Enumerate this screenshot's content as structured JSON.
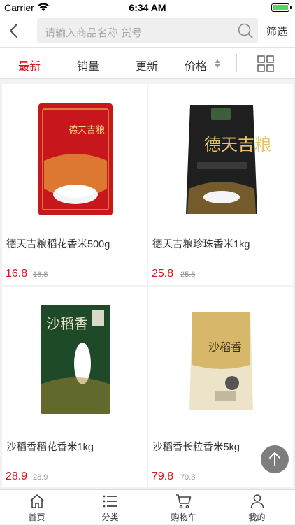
{
  "status_bar": {
    "carrier": "Carrier",
    "time": "6:34 AM"
  },
  "nav": {
    "search_placeholder": "请输入商品名称 货号",
    "filter_label": "筛选"
  },
  "sort_tabs": [
    {
      "label": "最新",
      "active": true
    },
    {
      "label": "销量",
      "active": false
    },
    {
      "label": "更新",
      "active": false
    },
    {
      "label": "价格",
      "active": false
    }
  ],
  "products": [
    {
      "name": "德天吉粮稻花香米500g",
      "price": "16.8",
      "old_price": "16.8",
      "pack_color": "#c8161d",
      "pack_text": "德天吉粮"
    },
    {
      "name": "德天吉粮珍珠香米1kg",
      "price": "25.8",
      "old_price": "25.8",
      "pack_color": "#1f1f1f",
      "pack_text": "德天吉粮"
    },
    {
      "name": "沙稻香稻花香米1kg",
      "price": "28.9",
      "old_price": "28.9",
      "pack_color": "#1e4a2a",
      "pack_text": "沙稻香"
    },
    {
      "name": "沙稻香长粒香米5kg",
      "price": "79.8",
      "old_price": "79.8",
      "pack_color": "#ede3c9",
      "pack_text": "沙稻香"
    }
  ],
  "tabbar": [
    {
      "label": "首页",
      "icon": "home-icon"
    },
    {
      "label": "分类",
      "icon": "list-icon"
    },
    {
      "label": "购物车",
      "icon": "cart-icon"
    },
    {
      "label": "我的",
      "icon": "user-icon"
    }
  ],
  "colors": {
    "accent": "#d9141a",
    "background": "#f2f2f2"
  }
}
